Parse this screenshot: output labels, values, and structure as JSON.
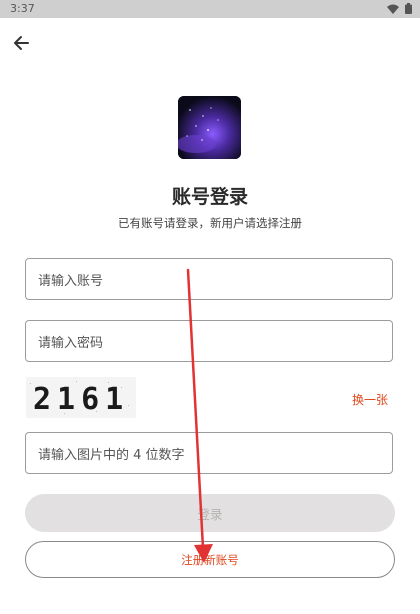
{
  "status_bar": {
    "time": "3:37",
    "icons": [
      "wifi-icon",
      "battery-icon"
    ]
  },
  "header": {
    "back_icon": "arrow-left-icon"
  },
  "logo": {
    "icon": "app-logo-galaxy"
  },
  "title": "账号登录",
  "subtitle": "已有账号请登录，新用户请选择注册",
  "form": {
    "account_placeholder": "请输入账号",
    "password_placeholder": "请输入密码",
    "captcha_text": "2161",
    "refresh_label": "换一张",
    "captcha_input_placeholder": "请输入图片中的 4 位数字"
  },
  "buttons": {
    "login_label": "登录",
    "register_label": "注册新账号"
  },
  "colors": {
    "accent": "#e0481e",
    "annotation_arrow": "#e23333",
    "disabled_button": "#e2e0e0"
  }
}
